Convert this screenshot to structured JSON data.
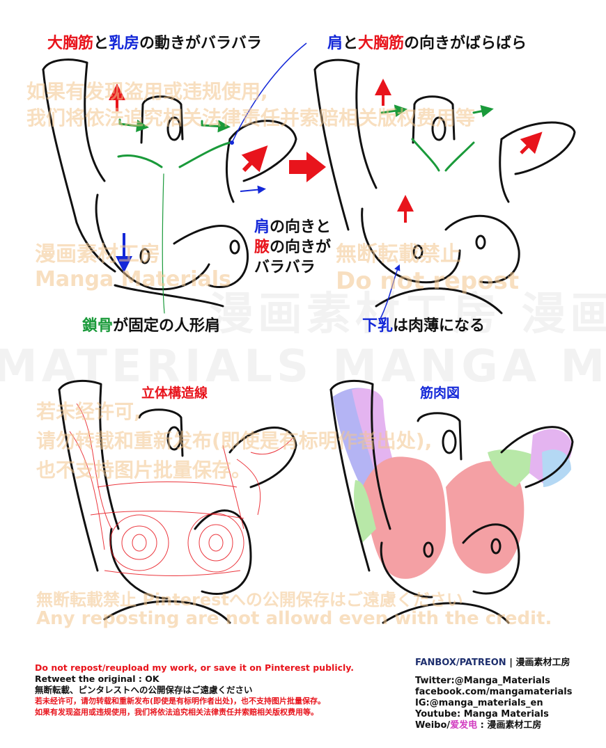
{
  "captions": {
    "tl_p1": "大胸筋",
    "tl_p2": "と",
    "tl_p3": "乳房",
    "tl_p4": "の動きがバラバラ",
    "tr_p1": "肩",
    "tr_p2": "と",
    "tr_p3": "大胸筋",
    "tr_p4": "の向きがばらばら",
    "mid_l1a": "肩",
    "mid_l1b": "の向きと",
    "mid_l2a": "腋",
    "mid_l2b": "の向きが",
    "mid_l3": "バラバラ",
    "bl_a": "鎖骨",
    "bl_b": "が固定の人形肩",
    "br_a": "下乳",
    "br_b": "は肉薄になる",
    "lower_left": "立体構造線",
    "lower_right": "筋肉図"
  },
  "watermarks": {
    "cn_top_1": "如果有发现盗用或违规使用,",
    "cn_top_2": "我们将依法追究相关法律责任并索赔相关版权费用等",
    "jp_studio": "漫画素材工房",
    "en_studio": "Manga Materials",
    "jp_nodl": "無断転載禁止",
    "en_nodl": "Do not repost",
    "cn_mid_1": "若未经许可,",
    "cn_mid_2": "请勿转载和重新发布(即使是有标明作者出处),",
    "cn_mid_3": "也不支持图片批量保存。",
    "jp_bottom": "無断転載禁止 Pinterestへの公開保存はご遠慮ください",
    "en_bottom": "Any reposting are not allowd even with the credit.",
    "band_1": "MATERIALS MANGA MATERIALS MANGA MA",
    "band_2": "漫画素材工房 漫画素材工房"
  },
  "footer": {
    "left_1": "Do not repost/reupload my work, or save it on Pinterest publicly.",
    "left_2": "Retweet the original : OK",
    "left_3": "無断転載、ピンタレストへの公開保存はご遠慮ください",
    "left_4": "若未经许可，请勿转载和重新发布(即使是有标明作者出处)，也不支持图片批量保存。",
    "left_5": "如果有发现盗用或违规使用，我们将依法追究相关法律责任并索赔相关版权费用等。",
    "right_1": "FANBOX/PATREON",
    "right_1b": " | 漫画素材工房",
    "right_2": "Twitter:@Manga_Materials",
    "right_3": "facebook.com/mangamaterials",
    "right_4": "IG:@manga_materials_en",
    "right_5": "Youtube: Manga Materials",
    "right_6a": "Weibo/",
    "right_6b": "爱发电",
    "right_6c": " : 漫画素材工房"
  },
  "colors": {
    "red": "#e8141c",
    "blue": "#1428d8",
    "green": "#1a9a3a",
    "navy": "#1e2f6e",
    "watermark": "#f2c48c",
    "muscle_pink": "#f4a0a4",
    "muscle_blue": "#b4b4f4",
    "muscle_green": "#b8e8a8",
    "muscle_purple": "#e4b4f0"
  },
  "icons": [
    "arrow-icon",
    "torso-drawing"
  ]
}
